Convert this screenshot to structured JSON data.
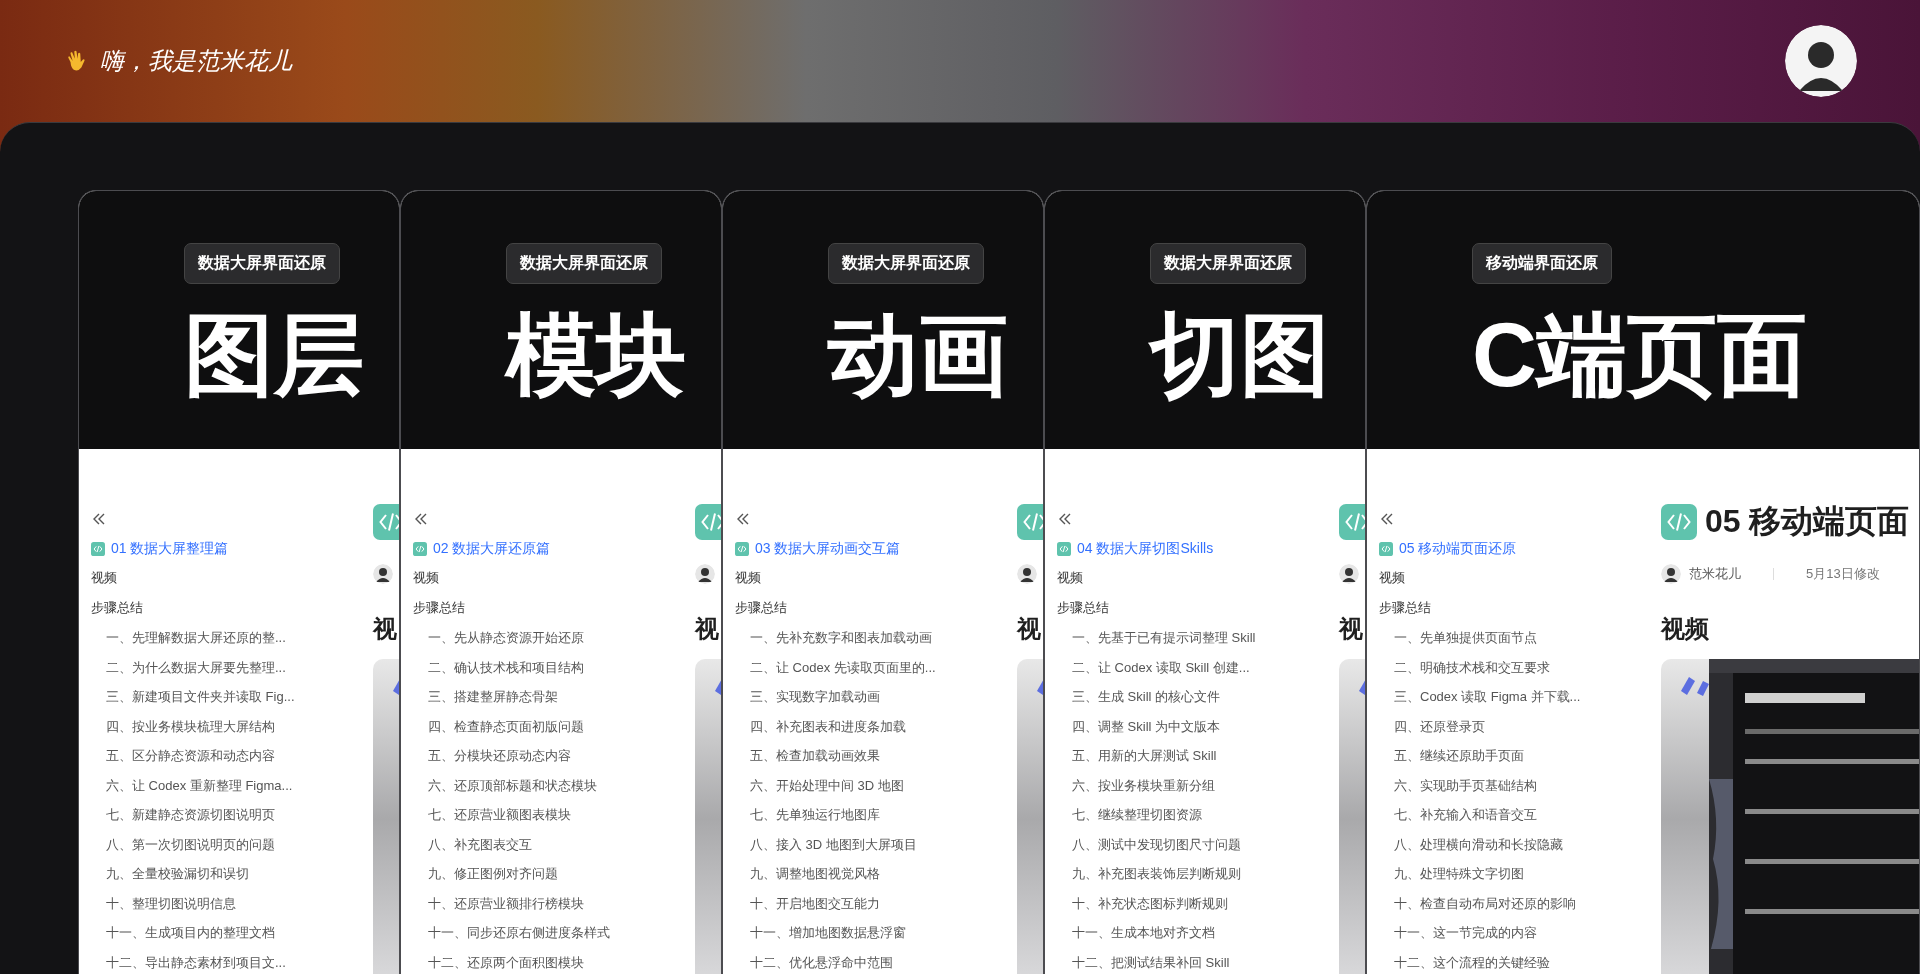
{
  "header": {
    "greeting": "嗨，我是范米花儿"
  },
  "cards": [
    {
      "badge": "数据大屏界面还原",
      "title": "图层",
      "doc_title": "01 数据大屏整理篇",
      "nav": [
        "视频",
        "步骤总结"
      ],
      "video_heading": "视",
      "steps": [
        "一、先理解数据大屏还原的整...",
        "二、为什么数据大屏要先整理...",
        "三、新建项目文件夹并读取 Fig...",
        "四、按业务模块梳理大屏结构",
        "五、区分静态资源和动态内容",
        "六、让 Codex 重新整理 Figma...",
        "七、新建静态资源切图说明页",
        "八、第一次切图说明页的问题",
        "九、全量校验漏切和误切",
        "十、整理切图说明信息",
        "十一、生成项目内的整理文档",
        "十二、导出静态素材到项目文..."
      ]
    },
    {
      "badge": "数据大屏界面还原",
      "title": "模块",
      "doc_title": "02 数据大屏还原篇",
      "nav": [
        "视频",
        "步骤总结"
      ],
      "video_heading": "视",
      "steps": [
        "一、先从静态资源开始还原",
        "二、确认技术栈和项目结构",
        "三、搭建整屏静态骨架",
        "四、检查静态页面初版问题",
        "五、分模块还原动态内容",
        "六、还原顶部标题和状态模块",
        "七、还原营业额图表模块",
        "八、补充图表交互",
        "九、修正图例对齐问题",
        "十、还原营业额排行榜模块",
        "十一、同步还原右侧进度条样式",
        "十二、还原两个面积图模块"
      ]
    },
    {
      "badge": "数据大屏界面还原",
      "title": "动画",
      "doc_title": "03 数据大屏动画交互篇",
      "nav": [
        "视频",
        "步骤总结"
      ],
      "video_heading": "视",
      "steps": [
        "一、先补充数字和图表加载动画",
        "二、让 Codex 先读取页面里的...",
        "三、实现数字加载动画",
        "四、补充图表和进度条加载",
        "五、检查加载动画效果",
        "六、开始处理中间 3D 地图",
        "七、先单独运行地图库",
        "八、接入 3D 地图到大屏项目",
        "九、调整地图视觉风格",
        "十、开启地图交互能力",
        "十一、增加地图数据悬浮窗",
        "十二、优化悬浮命中范围"
      ]
    },
    {
      "badge": "数据大屏界面还原",
      "title": "切图",
      "doc_title": "04 数据大屏切图Skills",
      "nav": [
        "视频",
        "步骤总结"
      ],
      "video_heading": "视",
      "steps": [
        "一、先基于已有提示词整理 Skill",
        "二、让 Codex 读取 Skill 创建...",
        "三、生成 Skill 的核心文件",
        "四、调整 Skill 为中文版本",
        "五、用新的大屏测试 Skill",
        "六、按业务模块重新分组",
        "七、继续整理切图资源",
        "八、测试中发现切图尺寸问题",
        "九、补充图表装饰层判断规则",
        "十、补充状态图标判断规则",
        "十一、生成本地对齐文档",
        "十二、把测试结果补回 Skill"
      ]
    },
    {
      "badge": "移动端界面还原",
      "title": "C端页面",
      "doc_title": "05 移动端页面还原",
      "nav": [
        "视频",
        "步骤总结"
      ],
      "video_heading": "视频",
      "heading": "05 移动端页面",
      "author": "范米花儿",
      "modified": "5月13日修改",
      "steps": [
        "一、先单独提供页面节点",
        "二、明确技术栈和交互要求",
        "三、Codex 读取 Figma 并下载...",
        "四、还原登录页",
        "五、继续还原助手页面",
        "六、实现助手页基础结构",
        "七、补充输入和语音交互",
        "八、处理横向滑动和长按隐藏",
        "九、处理特殊文字切图",
        "十、检查自动布局对还原的影响",
        "十一、这一节完成的内容",
        "十二、这个流程的关键经验"
      ]
    }
  ]
}
